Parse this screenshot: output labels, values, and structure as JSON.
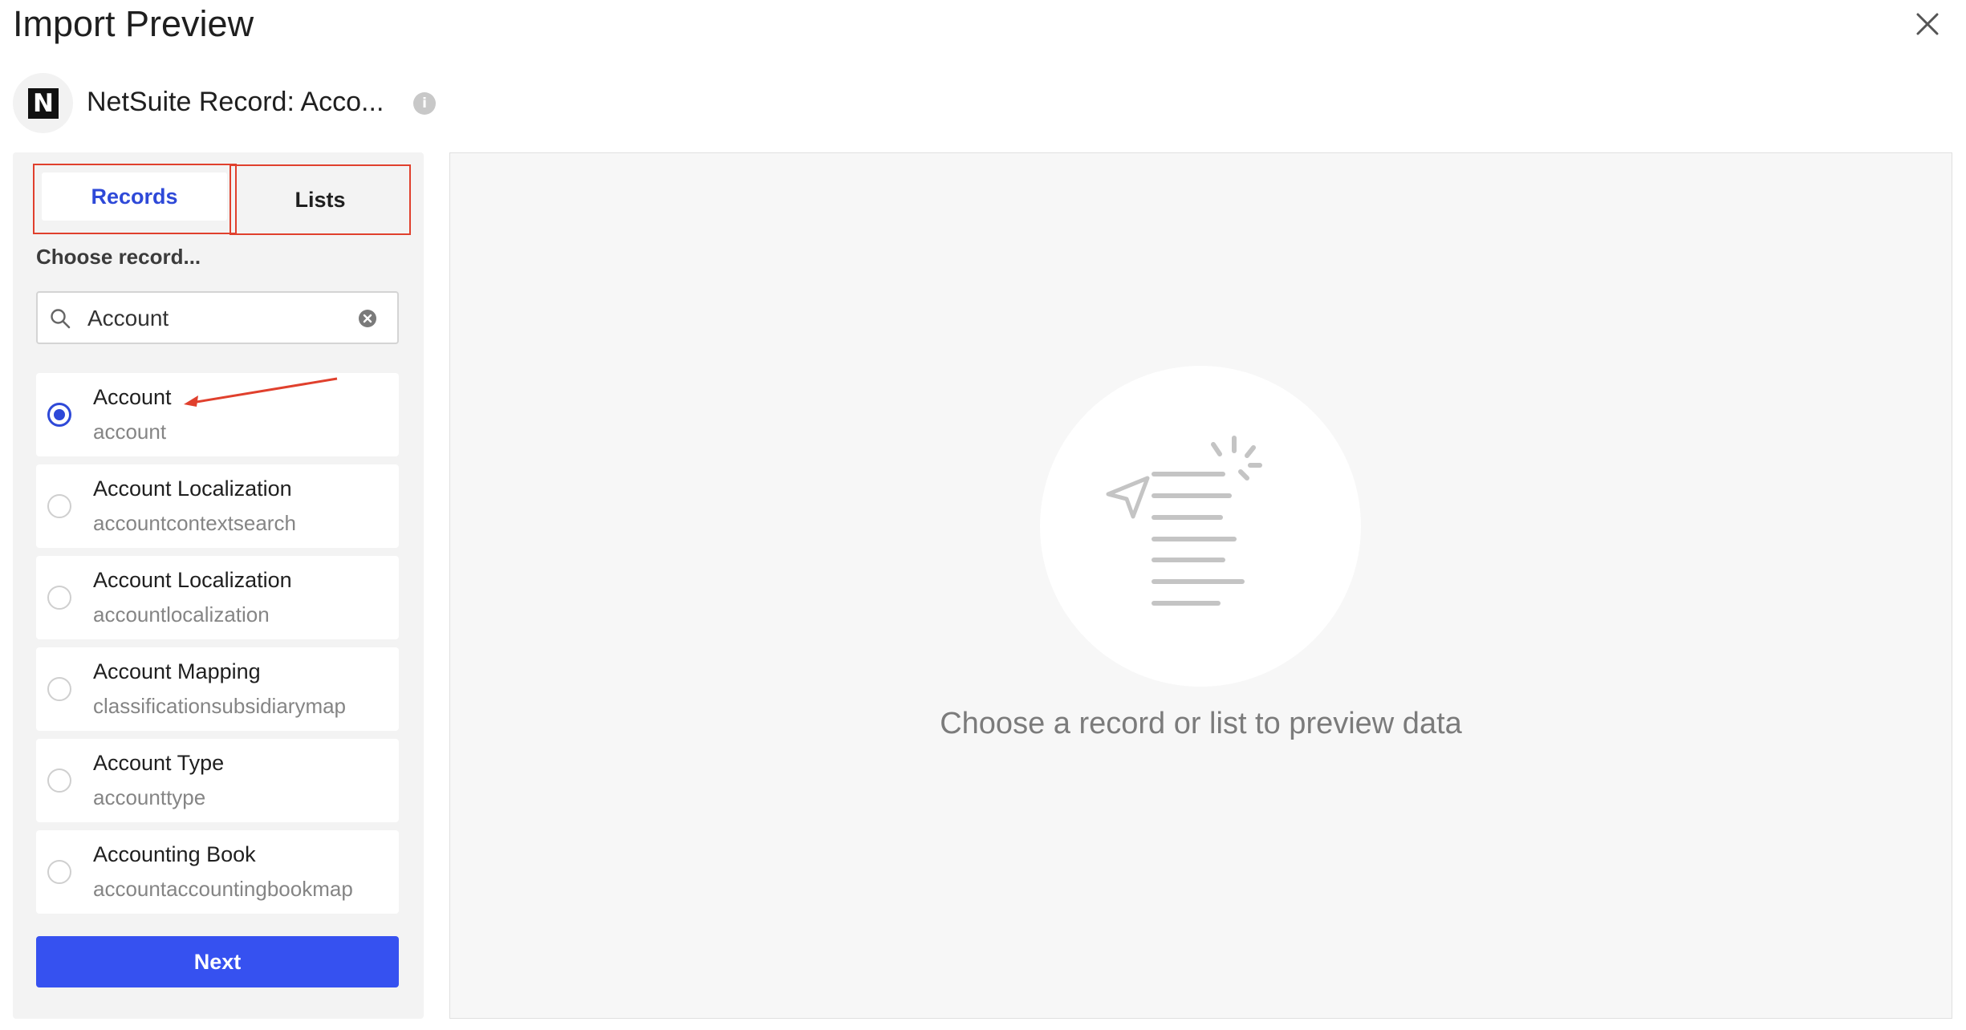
{
  "header": {
    "title": "Import Preview",
    "record_title": "NetSuite Record: Acco...",
    "logo_letter": "N",
    "info_glyph": "i"
  },
  "tabs": {
    "records_label": "Records",
    "lists_label": "Lists",
    "active": "Records"
  },
  "picker": {
    "choose_label": "Choose record...",
    "search_value": "Account",
    "items": [
      {
        "label": "Account",
        "sub": "account",
        "selected": true
      },
      {
        "label": "Account Localization",
        "sub": "accountcontextsearch",
        "selected": false
      },
      {
        "label": "Account Localization",
        "sub": "accountlocalization",
        "selected": false
      },
      {
        "label": "Account Mapping",
        "sub": "classificationsubsidiarymap",
        "selected": false
      },
      {
        "label": "Account Type",
        "sub": "accounttype",
        "selected": false
      },
      {
        "label": "Accounting Book",
        "sub": "accountaccountingbookmap",
        "selected": false
      }
    ],
    "next_label": "Next"
  },
  "preview": {
    "empty_message": "Choose a record or list to preview data"
  },
  "colors": {
    "accent": "#3651f0",
    "annotation": "#e0402d"
  }
}
